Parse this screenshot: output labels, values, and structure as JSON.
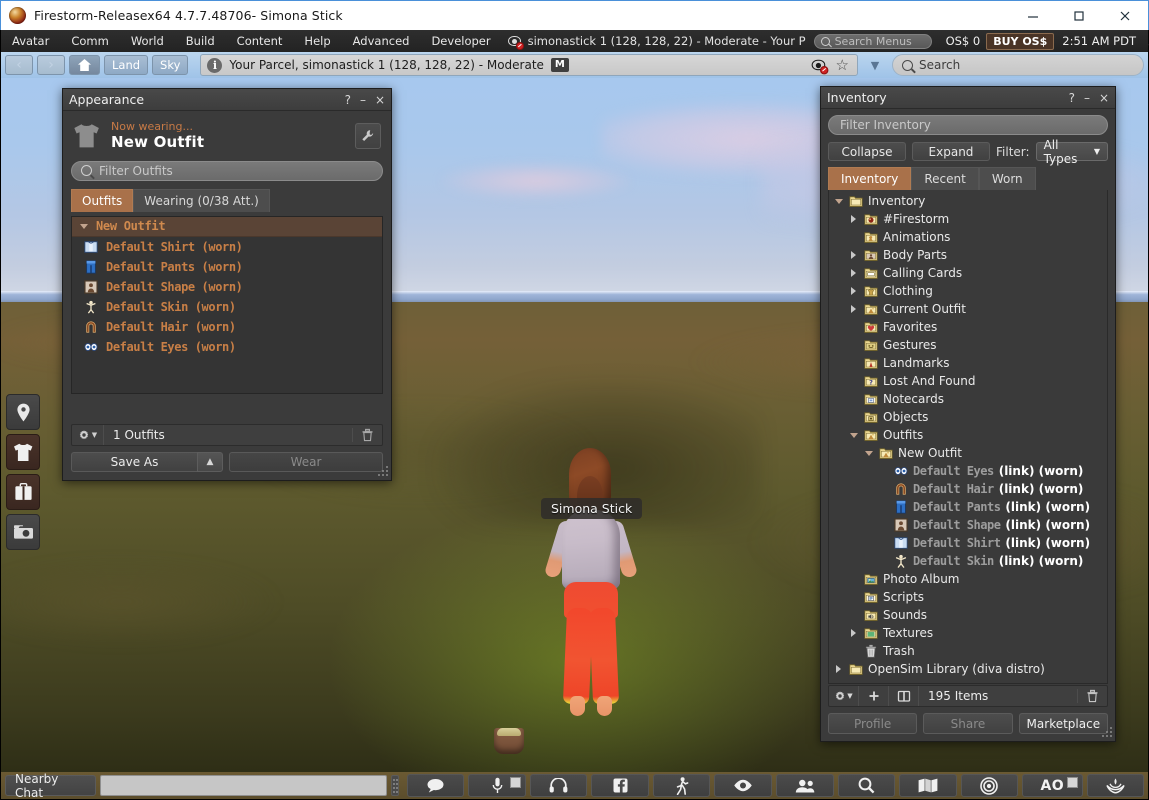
{
  "window": {
    "title": "Firestorm-Releasex64 4.7.7.48706- Simona Stick",
    "minimize": "–",
    "maximize": "□",
    "close": "×"
  },
  "menubar": {
    "items": [
      "Avatar",
      "Comm",
      "World",
      "Build",
      "Content",
      "Help",
      "Advanced",
      "Developer"
    ],
    "location_status": "simonastick 1 (128, 128, 22) - Moderate - Your P",
    "search_menus_placeholder": "Search Menus",
    "balance": "OS$ 0",
    "buy_label": "BUY OS$",
    "clock": "2:51 AM PDT"
  },
  "navbar": {
    "back": "‹",
    "forward": "›",
    "home_icon": "home-icon",
    "land_label": "Land",
    "sky_label": "Sky",
    "location_text": "Your Parcel, simonastick 1 (128, 128, 22) - Moderate",
    "maturity_badge": "M",
    "search_placeholder": "Search"
  },
  "left_toolbar": {
    "items": [
      {
        "name": "place-pin-icon",
        "active": false
      },
      {
        "name": "appearance-shirt-icon",
        "active": true
      },
      {
        "name": "inventory-bag-icon",
        "active": true
      },
      {
        "name": "snapshot-camera-icon",
        "active": false
      }
    ]
  },
  "world": {
    "avatar_nametag": "Simona Stick"
  },
  "appearance": {
    "title": "Appearance",
    "help": "?",
    "minimize": "–",
    "close": "×",
    "now_wearing_label": "Now wearing...",
    "outfit_name": "New Outfit",
    "filter_placeholder": "Filter Outfits",
    "tabs": [
      {
        "label": "Outfits",
        "active": true
      },
      {
        "label": "Wearing (0/38 Att.)",
        "active": false
      }
    ],
    "group": {
      "label": "New Outfit",
      "expanded": true
    },
    "items": [
      {
        "label": "Default Shirt (worn)",
        "icon": "shirt-item-icon"
      },
      {
        "label": "Default Pants (worn)",
        "icon": "pants-item-icon"
      },
      {
        "label": "Default Shape (worn)",
        "icon": "shape-item-icon"
      },
      {
        "label": "Default Skin (worn)",
        "icon": "skin-item-icon"
      },
      {
        "label": "Default Hair (worn)",
        "icon": "hair-item-icon"
      },
      {
        "label": "Default Eyes (worn)",
        "icon": "eyes-item-icon"
      }
    ],
    "count_text": "1 Outfits",
    "save_as_label": "Save As",
    "wear_label": "Wear"
  },
  "inventory": {
    "title": "Inventory",
    "help": "?",
    "minimize": "–",
    "close": "×",
    "filter_placeholder": "Filter Inventory",
    "collapse_label": "Collapse",
    "expand_label": "Expand",
    "filter_label": "Filter:",
    "types_value": "All Types",
    "tabs": [
      {
        "label": "Inventory",
        "active": true
      },
      {
        "label": "Recent",
        "active": false
      },
      {
        "label": "Worn",
        "active": false
      }
    ],
    "tree": [
      {
        "label": "Inventory",
        "depth": 0,
        "twisty": "down",
        "icon": "folder-icon",
        "worn": false
      },
      {
        "label": "#Firestorm",
        "depth": 1,
        "twisty": "right",
        "icon": "folder-firestorm-icon",
        "worn": false
      },
      {
        "label": "Animations",
        "depth": 1,
        "twisty": "none",
        "icon": "folder-animations-icon",
        "worn": false
      },
      {
        "label": "Body Parts",
        "depth": 1,
        "twisty": "right",
        "icon": "folder-bodyparts-icon",
        "worn": false
      },
      {
        "label": "Calling Cards",
        "depth": 1,
        "twisty": "right",
        "icon": "folder-callingcards-icon",
        "worn": false
      },
      {
        "label": "Clothing",
        "depth": 1,
        "twisty": "right",
        "icon": "folder-clothing-icon",
        "worn": false
      },
      {
        "label": "Current Outfit",
        "depth": 1,
        "twisty": "right",
        "icon": "folder-outfit-icon",
        "worn": false
      },
      {
        "label": "Favorites",
        "depth": 1,
        "twisty": "none",
        "icon": "folder-favorites-icon",
        "worn": false
      },
      {
        "label": "Gestures",
        "depth": 1,
        "twisty": "none",
        "icon": "folder-gestures-icon",
        "worn": false
      },
      {
        "label": "Landmarks",
        "depth": 1,
        "twisty": "none",
        "icon": "folder-landmarks-icon",
        "worn": false
      },
      {
        "label": "Lost And Found",
        "depth": 1,
        "twisty": "none",
        "icon": "folder-lostandfound-icon",
        "worn": false
      },
      {
        "label": "Notecards",
        "depth": 1,
        "twisty": "none",
        "icon": "folder-notecards-icon",
        "worn": false
      },
      {
        "label": "Objects",
        "depth": 1,
        "twisty": "none",
        "icon": "folder-objects-icon",
        "worn": false
      },
      {
        "label": "Outfits",
        "depth": 1,
        "twisty": "down",
        "icon": "folder-outfit-icon",
        "worn": false
      },
      {
        "label": "New Outfit",
        "depth": 2,
        "twisty": "down",
        "icon": "folder-outfit-icon",
        "worn": false
      },
      {
        "label": "Default Eyes",
        "suffix": "(link) (worn)",
        "depth": 3,
        "twisty": "none",
        "icon": "eyes-item-icon",
        "worn": true
      },
      {
        "label": "Default Hair",
        "suffix": "(link) (worn)",
        "depth": 3,
        "twisty": "none",
        "icon": "hair-item-icon",
        "worn": true
      },
      {
        "label": "Default Pants",
        "suffix": "(link) (worn)",
        "depth": 3,
        "twisty": "none",
        "icon": "pants-item-icon",
        "worn": true
      },
      {
        "label": "Default Shape",
        "suffix": "(link) (worn)",
        "depth": 3,
        "twisty": "none",
        "icon": "shape-item-icon",
        "worn": true
      },
      {
        "label": "Default Shirt",
        "suffix": "(link) (worn)",
        "depth": 3,
        "twisty": "none",
        "icon": "shirt-item-icon",
        "worn": true
      },
      {
        "label": "Default Skin",
        "suffix": "(link) (worn)",
        "depth": 3,
        "twisty": "none",
        "icon": "skin-item-icon",
        "worn": true
      },
      {
        "label": "Photo Album",
        "depth": 1,
        "twisty": "none",
        "icon": "folder-photoalbum-icon",
        "worn": false
      },
      {
        "label": "Scripts",
        "depth": 1,
        "twisty": "none",
        "icon": "folder-scripts-icon",
        "worn": false
      },
      {
        "label": "Sounds",
        "depth": 1,
        "twisty": "none",
        "icon": "folder-sounds-icon",
        "worn": false
      },
      {
        "label": "Textures",
        "depth": 1,
        "twisty": "right",
        "icon": "folder-textures-icon",
        "worn": false
      },
      {
        "label": "Trash",
        "depth": 1,
        "twisty": "none",
        "icon": "trash-icon",
        "worn": false
      },
      {
        "label": "OpenSim Library (diva distro)",
        "depth": 0,
        "twisty": "right",
        "icon": "folder-icon",
        "worn": false
      }
    ],
    "count_text": "195 Items",
    "profile_label": "Profile",
    "share_label": "Share",
    "marketplace_label": "Marketplace"
  },
  "bottombar": {
    "nearby_chat_label": "Nearby Chat",
    "chat_value": "",
    "buttons": [
      {
        "name": "chat-bubble-icon",
        "label": ""
      },
      {
        "name": "microphone-icon",
        "label": "",
        "checkbox": true
      },
      {
        "name": "headset-icon",
        "label": ""
      },
      {
        "name": "facebook-icon",
        "label": ""
      },
      {
        "name": "walk-run-fly-icon",
        "label": ""
      },
      {
        "name": "eye-view-icon",
        "label": ""
      },
      {
        "name": "people-icon",
        "label": ""
      },
      {
        "name": "search-icon",
        "label": ""
      },
      {
        "name": "map-icon",
        "label": ""
      },
      {
        "name": "mini-map-icon",
        "label": ""
      },
      {
        "name": "ao-toggle",
        "label": "AO",
        "checkbox": true
      },
      {
        "name": "phoenix-icon",
        "label": ""
      }
    ]
  },
  "colors": {
    "accent_brown": "#a9714a",
    "worn_orange": "#c87f46",
    "panel_bg": "#3b3b3b",
    "navbar_blue": "#9fc3e8"
  }
}
